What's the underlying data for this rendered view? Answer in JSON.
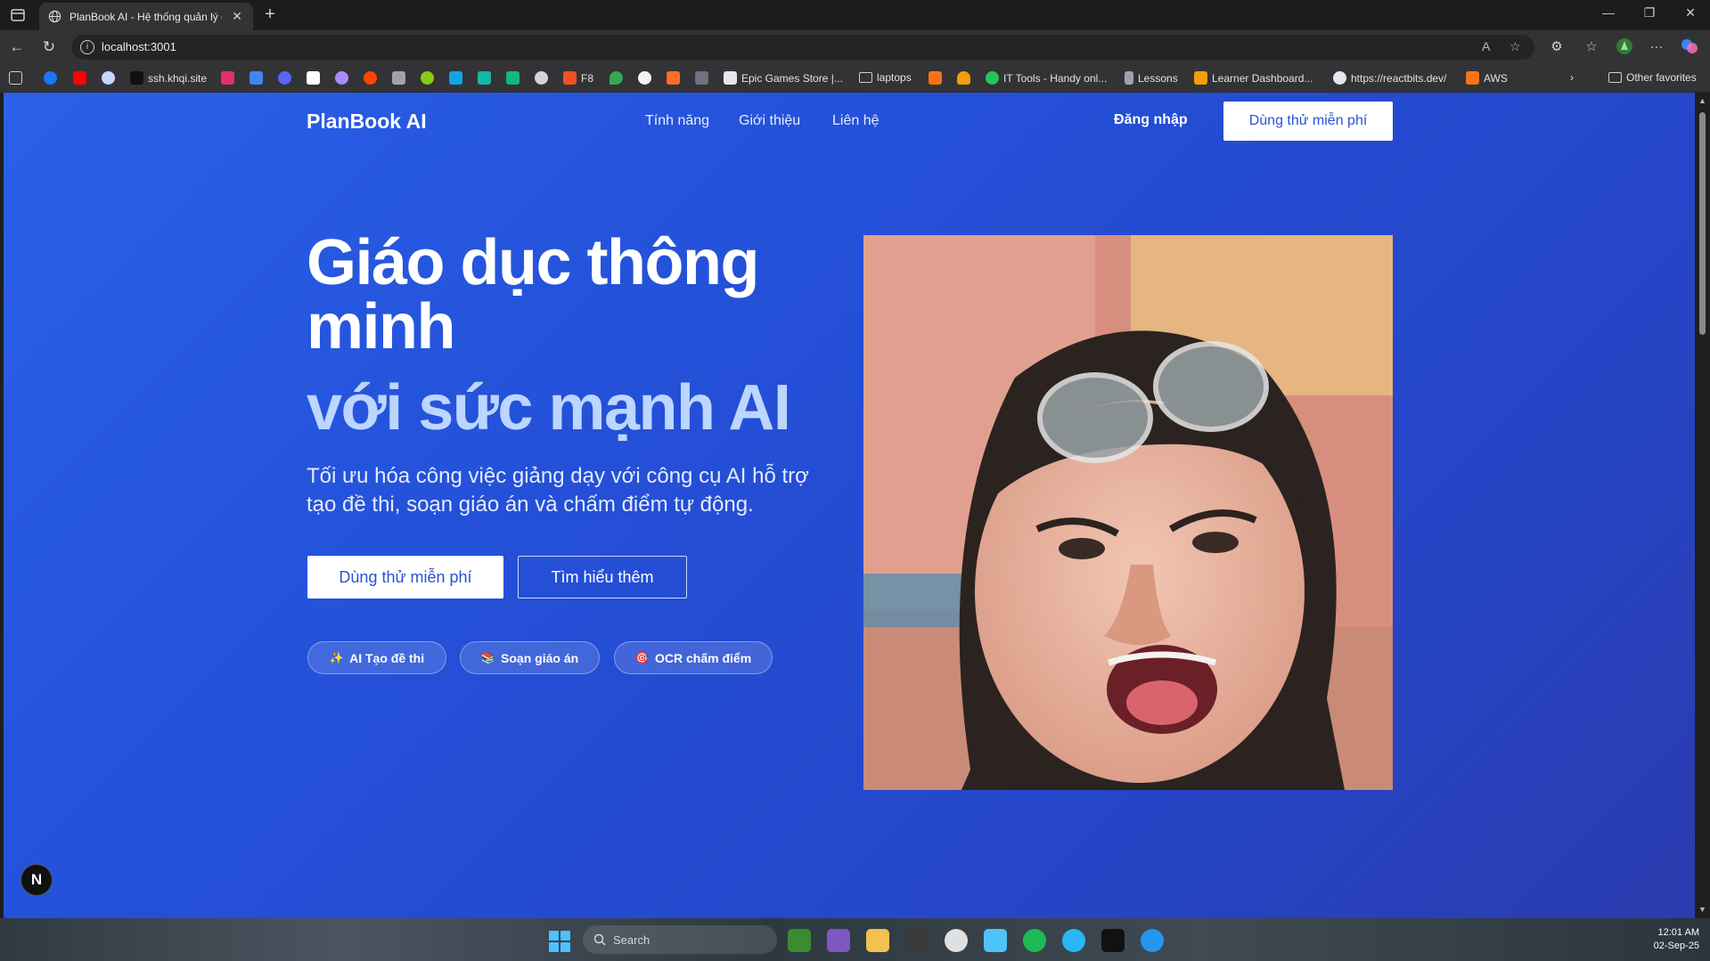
{
  "browser": {
    "tab_title": "PlanBook AI - Hệ thống quản lý g",
    "new_tab": "+",
    "close": "✕",
    "url": "localhost:3001",
    "favorites": [
      {
        "label": "ssh.khqi.site"
      },
      {
        "label": "F8"
      },
      {
        "label": "Epic Games Store |..."
      },
      {
        "label": "laptops"
      },
      {
        "label": "IT Tools - Handy onl..."
      },
      {
        "label": "Lessons"
      },
      {
        "label": "Learner Dashboard..."
      },
      {
        "label": "https://reactbits.dev/"
      },
      {
        "label": "AWS"
      },
      {
        "label": "Other favorites"
      }
    ]
  },
  "site": {
    "logo": "PlanBook AI",
    "nav": [
      "Tính năng",
      "Giới thiệu",
      "Liên hệ"
    ],
    "login": "Đăng nhập",
    "trial_button": "Dùng thử miễn phí"
  },
  "hero": {
    "title_line1": "Giáo dục thông minh",
    "title_line2": "với sức mạnh AI",
    "subtitle": "Tối ưu hóa công việc giảng dạy với công cụ AI hỗ trợ tạo đề thi, soạn giáo án và chấm điểm tự động.",
    "primary_button": "Dùng thử miễn phí",
    "secondary_button": "Tìm hiểu thêm",
    "features": [
      {
        "icon": "sparkles-icon",
        "label": "AI Tạo đề thi"
      },
      {
        "icon": "books-icon",
        "label": "Soạn giáo án"
      },
      {
        "icon": "target-icon",
        "label": "OCR chấm điểm"
      }
    ]
  },
  "badge": "N",
  "taskbar": {
    "search_placeholder": "Search",
    "time": "12:01 AM",
    "date": "02-Sep-25"
  },
  "colors": {
    "accent": "#2752d9",
    "hero_gradient_start": "#2b60e9",
    "hero_gradient_end": "#2a3cae",
    "title_highlight": "#bcd6ff"
  }
}
